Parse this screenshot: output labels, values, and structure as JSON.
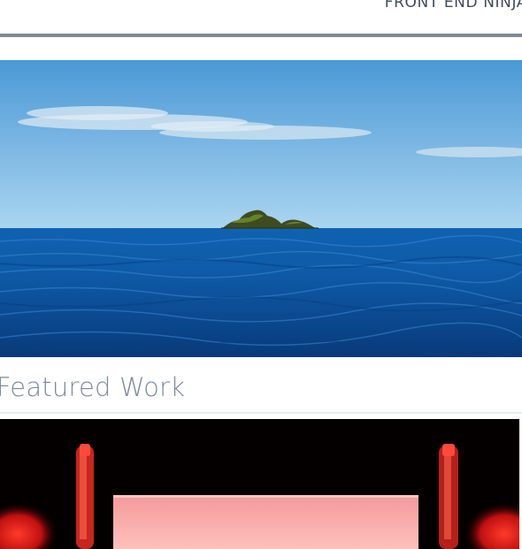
{
  "header": {
    "tagline": "FRONT END NINJA"
  },
  "hero": {
    "image": "ocean-island-photo",
    "colors": {
      "sky_top": "#4a9ad8",
      "sky_bottom": "#a8d3ef",
      "sea_top": "#0d5aa7",
      "sea_bottom": "#06316a",
      "island": "#3b4a1e"
    }
  },
  "featured": {
    "title": "Featured Work",
    "items": [
      {
        "image": "red-lights-photo"
      }
    ]
  },
  "colors": {
    "rule": "#7d8a9b",
    "heading": "#7b8a9c",
    "tagline": "#3f4b5a"
  }
}
